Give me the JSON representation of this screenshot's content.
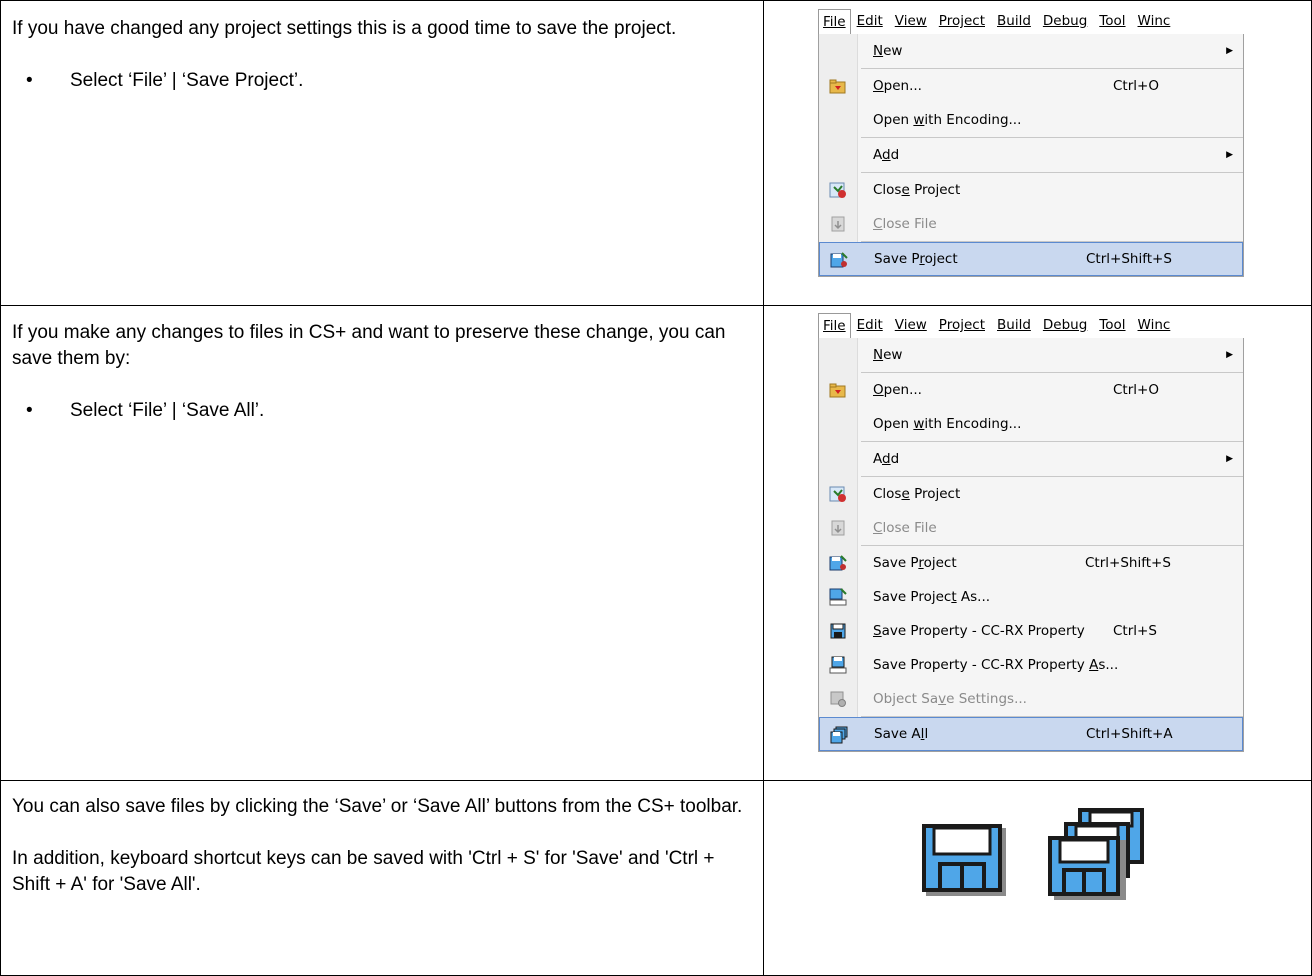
{
  "rows": [
    {
      "paragraph": "If you have changed any project settings this is a good time to save the project.",
      "bullet": "Select ‘File’ | ‘Save Project’."
    },
    {
      "paragraph": "If you make any changes to files in CS+ and want to preserve these change, you can save them by:",
      "bullet": "Select ‘File’ | ‘Save All’."
    },
    {
      "paragraph": "You can also save files by clicking the ‘Save’ or ‘Save All’ buttons from the CS+ toolbar.",
      "paragraph2": "In addition, keyboard shortcut keys can be saved with 'Ctrl + S' for 'Save' and 'Ctrl + Shift + A' for 'Save All'."
    }
  ],
  "menubar": [
    "File",
    "Edit",
    "View",
    "Project",
    "Build",
    "Debug",
    "Tool",
    "Winc"
  ],
  "menu1": {
    "items": [
      {
        "label": "New",
        "shortcut": "",
        "submenu": true
      },
      {
        "label": "Open...",
        "shortcut": "Ctrl+O",
        "icon": "open-folder-icon"
      },
      {
        "label": "Open with Encoding...",
        "shortcut": ""
      },
      {
        "label": "Add",
        "shortcut": "",
        "submenu": true
      },
      {
        "label": "Close Project",
        "shortcut": "",
        "icon": "close-project-icon"
      },
      {
        "label": "Close File",
        "shortcut": "",
        "icon": "close-file-icon",
        "disabled": true
      },
      {
        "label": "Save Project",
        "shortcut": "Ctrl+Shift+S",
        "icon": "save-project-icon",
        "selected": true
      }
    ]
  },
  "menu2": {
    "items": [
      {
        "label": "New",
        "shortcut": "",
        "submenu": true
      },
      {
        "label": "Open...",
        "shortcut": "Ctrl+O",
        "icon": "open-folder-icon"
      },
      {
        "label": "Open with Encoding...",
        "shortcut": ""
      },
      {
        "label": "Add",
        "shortcut": "",
        "submenu": true
      },
      {
        "label": "Close Project",
        "shortcut": "",
        "icon": "close-project-icon"
      },
      {
        "label": "Close File",
        "shortcut": "",
        "icon": "close-file-icon",
        "disabled": true
      },
      {
        "label": "Save Project",
        "shortcut": "Ctrl+Shift+S",
        "icon": "save-project-icon"
      },
      {
        "label": "Save Project As...",
        "shortcut": "",
        "icon": "save-project-as-icon"
      },
      {
        "label": "Save Property - CC-RX Property",
        "shortcut": "Ctrl+S",
        "icon": "save-icon"
      },
      {
        "label": "Save Property - CC-RX Property As...",
        "shortcut": "",
        "icon": "save-as-icon"
      },
      {
        "label": "Object Save Settings...",
        "shortcut": "",
        "icon": "object-save-settings-icon",
        "disabled": true
      },
      {
        "label": "Save All",
        "shortcut": "Ctrl+Shift+A",
        "icon": "save-all-icon",
        "selected": true
      }
    ]
  },
  "toolbar_icons": [
    "save-icon",
    "save-all-icon"
  ]
}
